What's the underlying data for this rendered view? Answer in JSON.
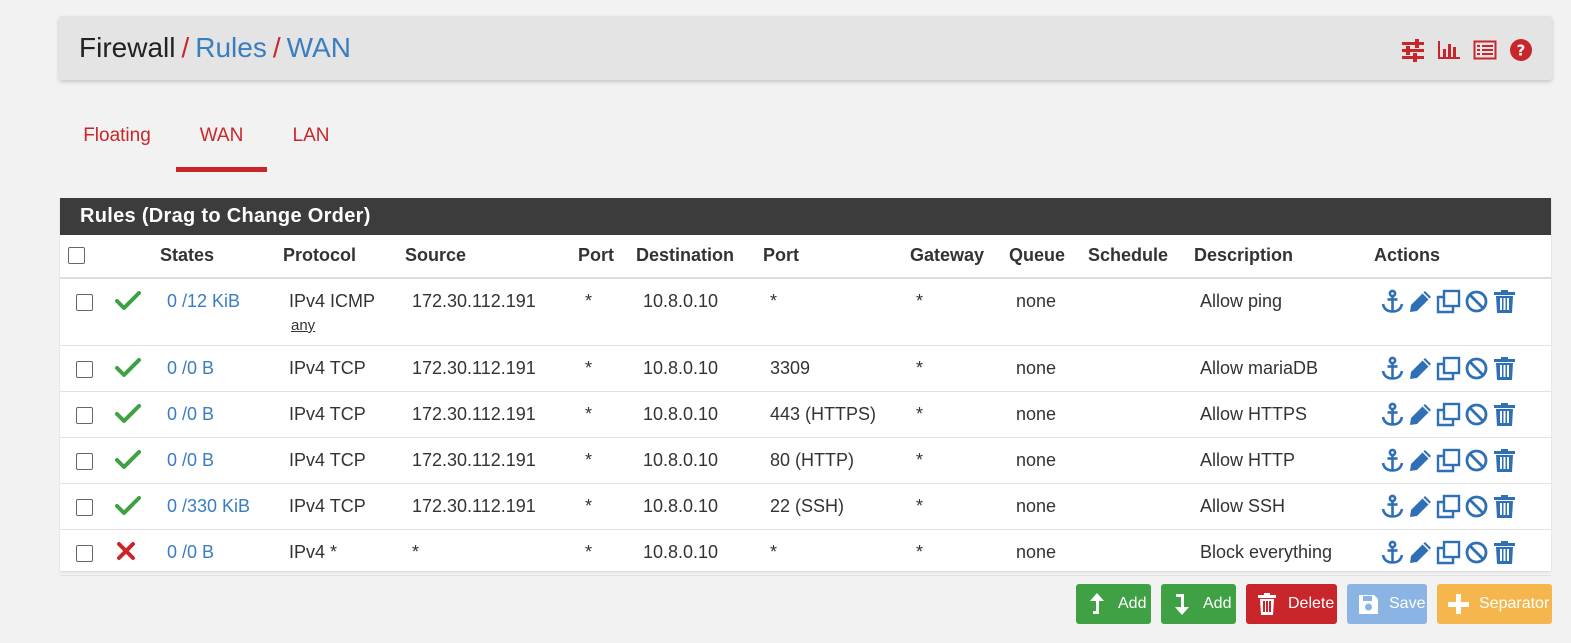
{
  "breadcrumb": {
    "item1": "Firewall",
    "sep": "/",
    "item2": "Rules",
    "item3": "WAN"
  },
  "tabs": [
    {
      "label": "Floating"
    },
    {
      "label": "WAN"
    },
    {
      "label": "LAN"
    }
  ],
  "active_tab": "WAN",
  "panel": {
    "title": "Rules (Drag to Change Order)",
    "columns": {
      "states": "States",
      "protocol": "Protocol",
      "source": "Source",
      "sport": "Port",
      "destination": "Destination",
      "dport": "Port",
      "gateway": "Gateway",
      "queue": "Queue",
      "schedule": "Schedule",
      "description": "Description",
      "actions": "Actions"
    }
  },
  "rules": [
    {
      "status": "pass",
      "states": "0 /12 KiB",
      "protocol": "IPv4 ICMP",
      "protocol_sub": "any",
      "source": "172.30.112.191",
      "sport": "*",
      "destination": "10.8.0.10",
      "dport": "*",
      "gateway": "*",
      "queue": "none",
      "schedule": "",
      "description": "Allow ping"
    },
    {
      "status": "pass",
      "states": "0 /0 B",
      "protocol": "IPv4 TCP",
      "source": "172.30.112.191",
      "sport": "*",
      "destination": "10.8.0.10",
      "dport": "3309",
      "gateway": "*",
      "queue": "none",
      "schedule": "",
      "description": "Allow mariaDB"
    },
    {
      "status": "pass",
      "states": "0 /0 B",
      "protocol": "IPv4 TCP",
      "source": "172.30.112.191",
      "sport": "*",
      "destination": "10.8.0.10",
      "dport": "443 (HTTPS)",
      "gateway": "*",
      "queue": "none",
      "schedule": "",
      "description": "Allow HTTPS"
    },
    {
      "status": "pass",
      "states": "0 /0 B",
      "protocol": "IPv4 TCP",
      "source": "172.30.112.191",
      "sport": "*",
      "destination": "10.8.0.10",
      "dport": "80 (HTTP)",
      "gateway": "*",
      "queue": "none",
      "schedule": "",
      "description": "Allow HTTP"
    },
    {
      "status": "pass",
      "states": "0 /330 KiB",
      "protocol": "IPv4 TCP",
      "source": "172.30.112.191",
      "sport": "*",
      "destination": "10.8.0.10",
      "dport": "22 (SSH)",
      "gateway": "*",
      "queue": "none",
      "schedule": "",
      "description": "Allow SSH"
    },
    {
      "status": "block",
      "states": "0 /0 B",
      "protocol": "IPv4 *",
      "source": "*",
      "sport": "*",
      "destination": "10.8.0.10",
      "dport": "*",
      "gateway": "*",
      "queue": "none",
      "schedule": "",
      "description": "Block everything"
    }
  ],
  "buttons": {
    "add_top": "Add",
    "add_bottom": "Add",
    "delete": "Delete",
    "save": "Save",
    "separator": "Separator"
  },
  "icons": {
    "header": [
      "sliders-icon",
      "bar-chart-icon",
      "list-icon",
      "help-icon"
    ],
    "row_actions": [
      "anchor-icon",
      "pencil-icon",
      "copy-icon",
      "disable-icon",
      "trash-icon"
    ]
  },
  "colors": {
    "accent": "#c9262b",
    "link": "#3a7dc0",
    "pass": "#3fa144",
    "block": "#c9262b",
    "panel_header": "#3c3c3c"
  }
}
